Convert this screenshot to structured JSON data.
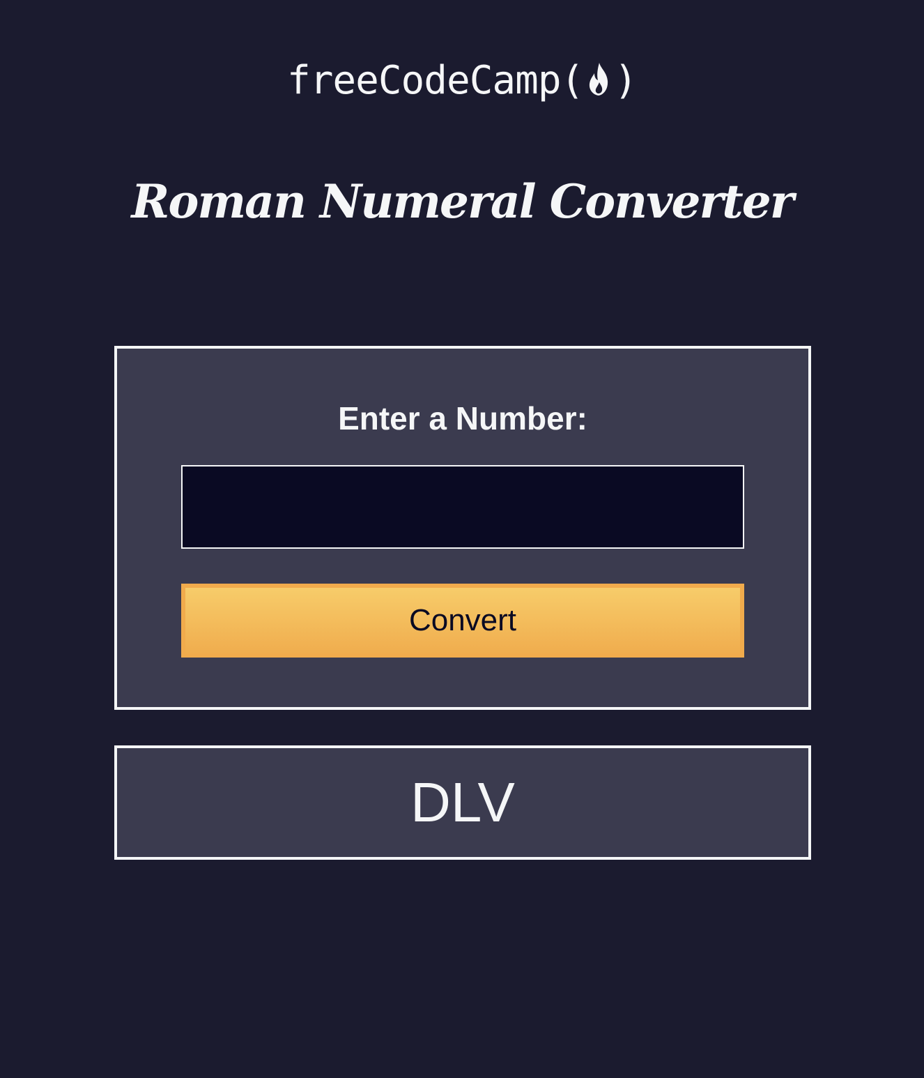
{
  "logo": {
    "text": "freeCodeCamp",
    "open_paren": "(",
    "close_paren": ")",
    "icon": "flame-icon"
  },
  "title": "Roman Numeral Converter",
  "form": {
    "label": "Enter a Number:",
    "input_value": "",
    "button_label": "Convert"
  },
  "output": {
    "text": "DLV"
  },
  "colors": {
    "background": "#1b1b2f",
    "panel": "#3b3b4f",
    "text": "#f5f6f7",
    "input_bg": "#0a0a23",
    "button_top": "#f7cc6a",
    "button_bottom": "#f0ad4e"
  }
}
